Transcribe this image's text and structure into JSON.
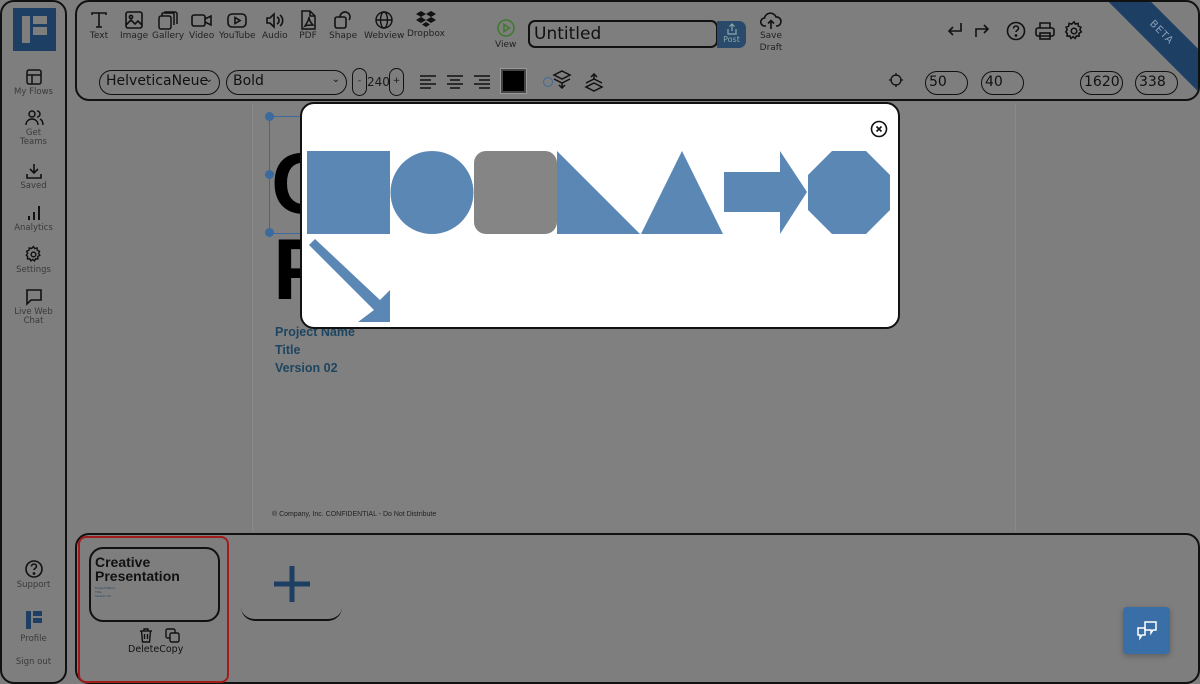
{
  "sidebar": {
    "items": [
      {
        "label": "My Flows",
        "icon": "layout-icon"
      },
      {
        "label": "Get Teams",
        "icon": "users-icon"
      },
      {
        "label": "Saved",
        "icon": "download-icon"
      },
      {
        "label": "Analytics",
        "icon": "bar-chart-icon"
      },
      {
        "label": "Settings",
        "icon": "gear-icon"
      },
      {
        "label": "Live Web Chat",
        "icon": "chat-icon"
      }
    ],
    "bottom": [
      {
        "label": "Support",
        "icon": "help-icon"
      },
      {
        "label": "Profile",
        "icon": "logo-icon"
      },
      {
        "label": "Sign out"
      }
    ]
  },
  "toolbar": {
    "tools": [
      {
        "label": "Text",
        "icon": "text-icon"
      },
      {
        "label": "Image",
        "icon": "image-icon"
      },
      {
        "label": "Gallery",
        "icon": "gallery-icon"
      },
      {
        "label": "Video",
        "icon": "video-icon"
      },
      {
        "label": "YouTube",
        "icon": "youtube-icon"
      },
      {
        "label": "Audio",
        "icon": "audio-icon"
      },
      {
        "label": "PDF",
        "icon": "pdf-icon"
      },
      {
        "label": "Shape",
        "icon": "shape-icon"
      },
      {
        "label": "Webview",
        "icon": "globe-icon"
      },
      {
        "label": "Dropbox",
        "icon": "dropbox-icon"
      }
    ],
    "view_label": "View",
    "title_value": "Untitled",
    "post_label": "Post",
    "save_draft_label": "Save Draft",
    "font_family": "HelveticaNeue",
    "font_weight": "Bold",
    "font_size": "240",
    "decrement_label": "-",
    "increment_label": "+",
    "pos_x": "50",
    "pos_y": "40",
    "width": "1620",
    "height": "338",
    "beta_label": "BETA",
    "colors": {
      "accent": "#1d3f63",
      "view_green": "#3f7a2e",
      "fill": "#000000"
    }
  },
  "canvas": {
    "heading_partial": [
      "C",
      "P"
    ],
    "meta": [
      "Project Name",
      "Title",
      "Version 02"
    ],
    "footer": "® Company, Inc. CONFIDENTIAL - Do Not Distribute"
  },
  "shape_picker": {
    "shapes": [
      "square",
      "circle",
      "rounded-square",
      "right-triangle",
      "triangle",
      "arrow-right",
      "octagon",
      "arrow-down-right"
    ],
    "colors": {
      "shape": "#5b87b5",
      "selected": "#858585"
    }
  },
  "slides": {
    "items": [
      {
        "title": "Creative Presentation",
        "meta": [
          "Project Name",
          "Title",
          "Version 02"
        ]
      }
    ],
    "delete_label": "Delete",
    "copy_label": "Copy",
    "add_label": "+"
  }
}
